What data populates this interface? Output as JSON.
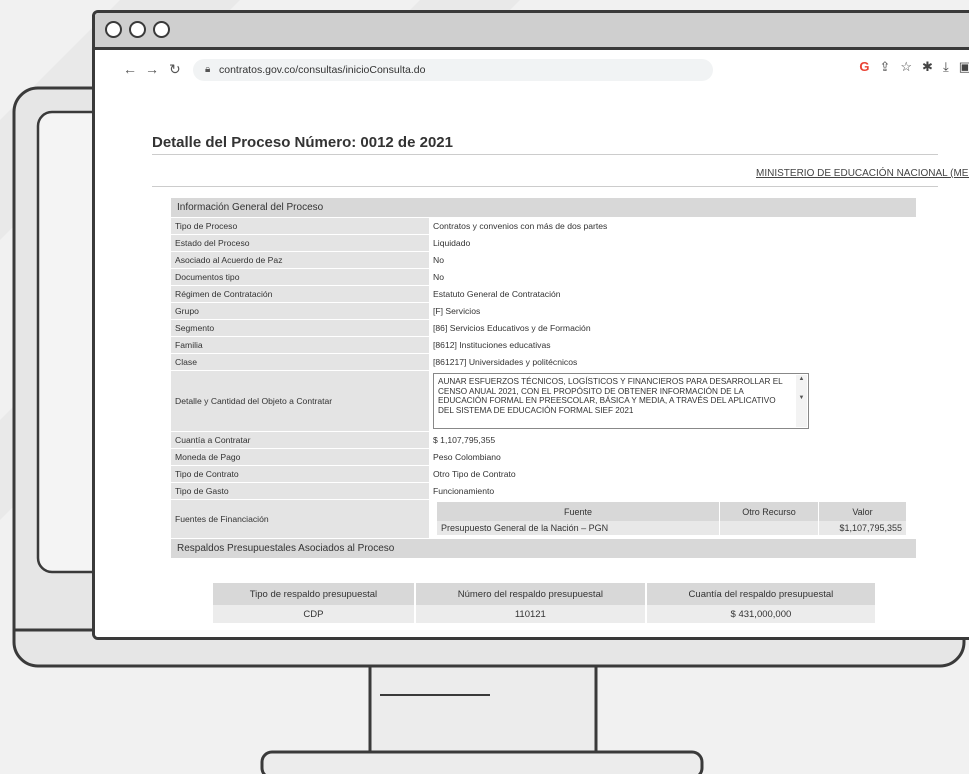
{
  "browser": {
    "url": "contratos.gov.co/consultas/inicioConsulta.do",
    "back_icon": "arrow-left-icon",
    "forward_icon": "arrow-right-icon",
    "reload_icon": "reload-icon"
  },
  "page": {
    "title": "Detalle del Proceso Número: 0012 de 2021",
    "entity": "MINISTERIO DE EDUCACIÓN NACIONAL (MEN)"
  },
  "general": {
    "section_title": "Información General del Proceso",
    "rows": [
      {
        "k": "Tipo de Proceso",
        "v": "Contratos y convenios con más de dos partes"
      },
      {
        "k": "Estado del Proceso",
        "v": "Liquidado"
      },
      {
        "k": "Asociado al Acuerdo de Paz",
        "v": "No"
      },
      {
        "k": "Documentos tipo",
        "v": "No"
      },
      {
        "k": "Régimen de Contratación",
        "v": "Estatuto General de Contratación"
      },
      {
        "k": "Grupo",
        "v": "[F] Servicios"
      },
      {
        "k": "Segmento",
        "v": "[86] Servicios Educativos y de Formación"
      },
      {
        "k": "Familia",
        "v": "[8612] Instituciones educativas"
      },
      {
        "k": "Clase",
        "v": "[861217] Universidades y politécnicos"
      }
    ],
    "detail_label": "Detalle y Cantidad del Objeto a Contratar",
    "detail_text": "AUNAR ESFUERZOS TÉCNICOS, LOGÍSTICOS Y FINANCIEROS PARA DESARROLLAR EL\nCENSO ANUAL 2021, CON EL PROPÓSITO DE OBTENER INFORMACIÓN DE LA EDUCACIÓN FORMAL EN PREESCOLAR, BÁSICA Y MEDIA, A TRAVÉS DEL APLICATIVO\nDEL SISTEMA DE EDUCACIÓN FORMAL SIEF 2021",
    "rows2": [
      {
        "k": "Cuantía a Contratar",
        "v": "$ 1,107,795,355"
      },
      {
        "k": "Moneda de Pago",
        "v": "Peso Colombiano"
      },
      {
        "k": "Tipo de Contrato",
        "v": "Otro Tipo de Contrato"
      },
      {
        "k": "Tipo de Gasto",
        "v": "Funcionamiento"
      }
    ],
    "funding_label": "Fuentes de Financiación",
    "funding": {
      "headers": [
        "Fuente",
        "Otro Recurso",
        "Valor"
      ],
      "row": [
        "Presupuesto General de la Nación – PGN",
        "",
        "$1,107,795,355"
      ]
    }
  },
  "budget": {
    "section_title": "Respaldos Presupuestales Asociados al Proceso",
    "headers": [
      "Tipo de respaldo presupuestal",
      "Número del respaldo presupuestal",
      "Cuantía del respaldo presupuestal"
    ],
    "row": [
      "CDP",
      "110121",
      "$ 431,000,000"
    ]
  }
}
